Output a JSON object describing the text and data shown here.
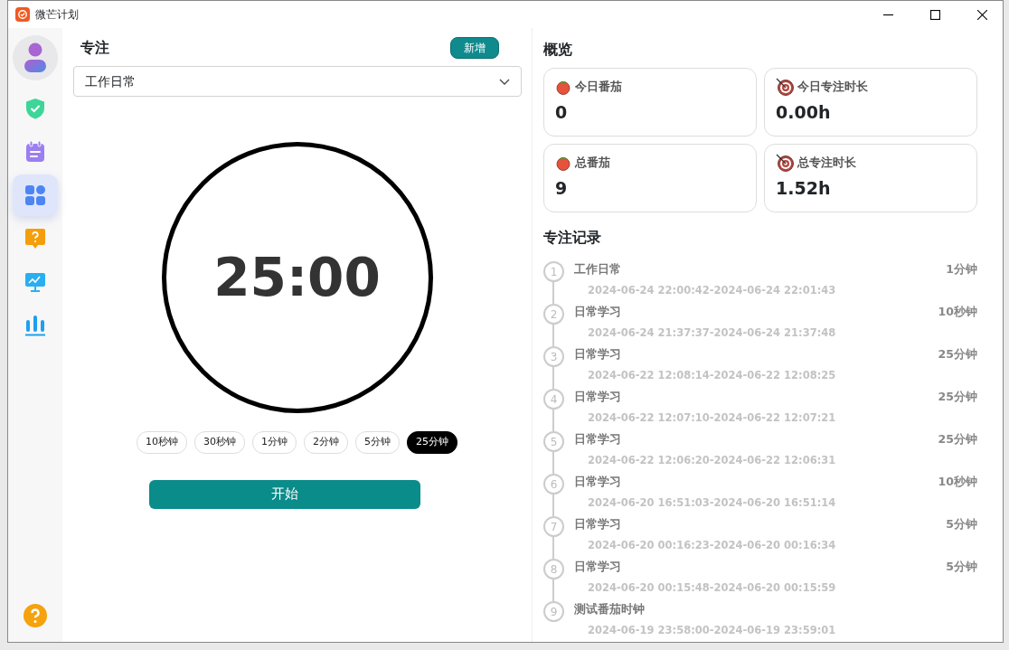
{
  "window": {
    "title": "微芒计划"
  },
  "sidebar": {
    "items": [
      {
        "kind": "avatar"
      },
      {
        "kind": "shield",
        "selected": false
      },
      {
        "kind": "calendar",
        "selected": false
      },
      {
        "kind": "grid",
        "selected": true
      },
      {
        "kind": "question",
        "selected": false
      },
      {
        "kind": "monitor",
        "selected": false
      },
      {
        "kind": "bars",
        "selected": false
      }
    ],
    "bottom": {
      "kind": "help"
    }
  },
  "focus": {
    "title": "专注",
    "add_button": "新增",
    "task_select": {
      "value": "工作日常"
    },
    "timer": "25:00",
    "durations": [
      {
        "label": "10秒钟",
        "selected": false
      },
      {
        "label": "30秒钟",
        "selected": false
      },
      {
        "label": "1分钟",
        "selected": false
      },
      {
        "label": "2分钟",
        "selected": false
      },
      {
        "label": "5分钟",
        "selected": false
      },
      {
        "label": "25分钟",
        "selected": true
      }
    ],
    "start_button": "开始"
  },
  "overview": {
    "title": "概览",
    "stats": [
      {
        "kind": "tomato",
        "label": "今日番茄",
        "value": "0"
      },
      {
        "kind": "target",
        "label": "今日专注时长",
        "value": "0.00h"
      },
      {
        "kind": "tomato",
        "label": "总番茄",
        "value": "9"
      },
      {
        "kind": "target",
        "label": "总专注时长",
        "value": "1.52h"
      }
    ]
  },
  "records": {
    "title": "专注记录",
    "items": [
      {
        "index": "1",
        "name": "工作日常",
        "duration": "1分钟",
        "time": "2024-06-24 22:00:42-2024-06-24 22:01:43"
      },
      {
        "index": "2",
        "name": "日常学习",
        "duration": "10秒钟",
        "time": "2024-06-24 21:37:37-2024-06-24 21:37:48"
      },
      {
        "index": "3",
        "name": "日常学习",
        "duration": "25分钟",
        "time": "2024-06-22 12:08:14-2024-06-22 12:08:25"
      },
      {
        "index": "4",
        "name": "日常学习",
        "duration": "25分钟",
        "time": "2024-06-22 12:07:10-2024-06-22 12:07:21"
      },
      {
        "index": "5",
        "name": "日常学习",
        "duration": "25分钟",
        "time": "2024-06-22 12:06:20-2024-06-22 12:06:31"
      },
      {
        "index": "6",
        "name": "日常学习",
        "duration": "10秒钟",
        "time": "2024-06-20 16:51:03-2024-06-20 16:51:14"
      },
      {
        "index": "7",
        "name": "日常学习",
        "duration": "5分钟",
        "time": "2024-06-20 00:16:23-2024-06-20 00:16:34"
      },
      {
        "index": "8",
        "name": "日常学习",
        "duration": "5分钟",
        "time": "2024-06-20 00:15:48-2024-06-20 00:15:59"
      },
      {
        "index": "9",
        "name": "测试番茄时钟",
        "time": "2024-06-19 23:58:00-2024-06-19 23:59:01"
      }
    ]
  }
}
